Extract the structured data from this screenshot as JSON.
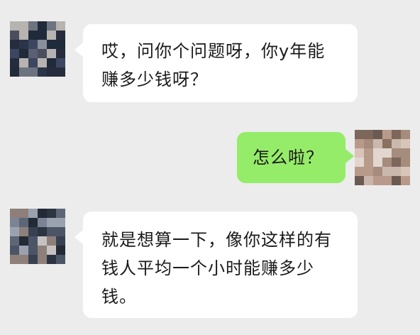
{
  "messages": [
    {
      "side": "left",
      "lines": [
        "哎，问你个问题呀，你y年能",
        "赚多少钱呀？"
      ]
    },
    {
      "side": "right",
      "lines": [
        "怎么啦？"
      ]
    },
    {
      "side": "left",
      "lines": [
        "就是想算一下，像你这样的有",
        "钱人平均一个小时能赚多少",
        "钱。"
      ]
    }
  ],
  "colors": {
    "background": "#ececec",
    "incoming_bubble": "#ffffff",
    "outgoing_bubble": "#95ec69"
  }
}
